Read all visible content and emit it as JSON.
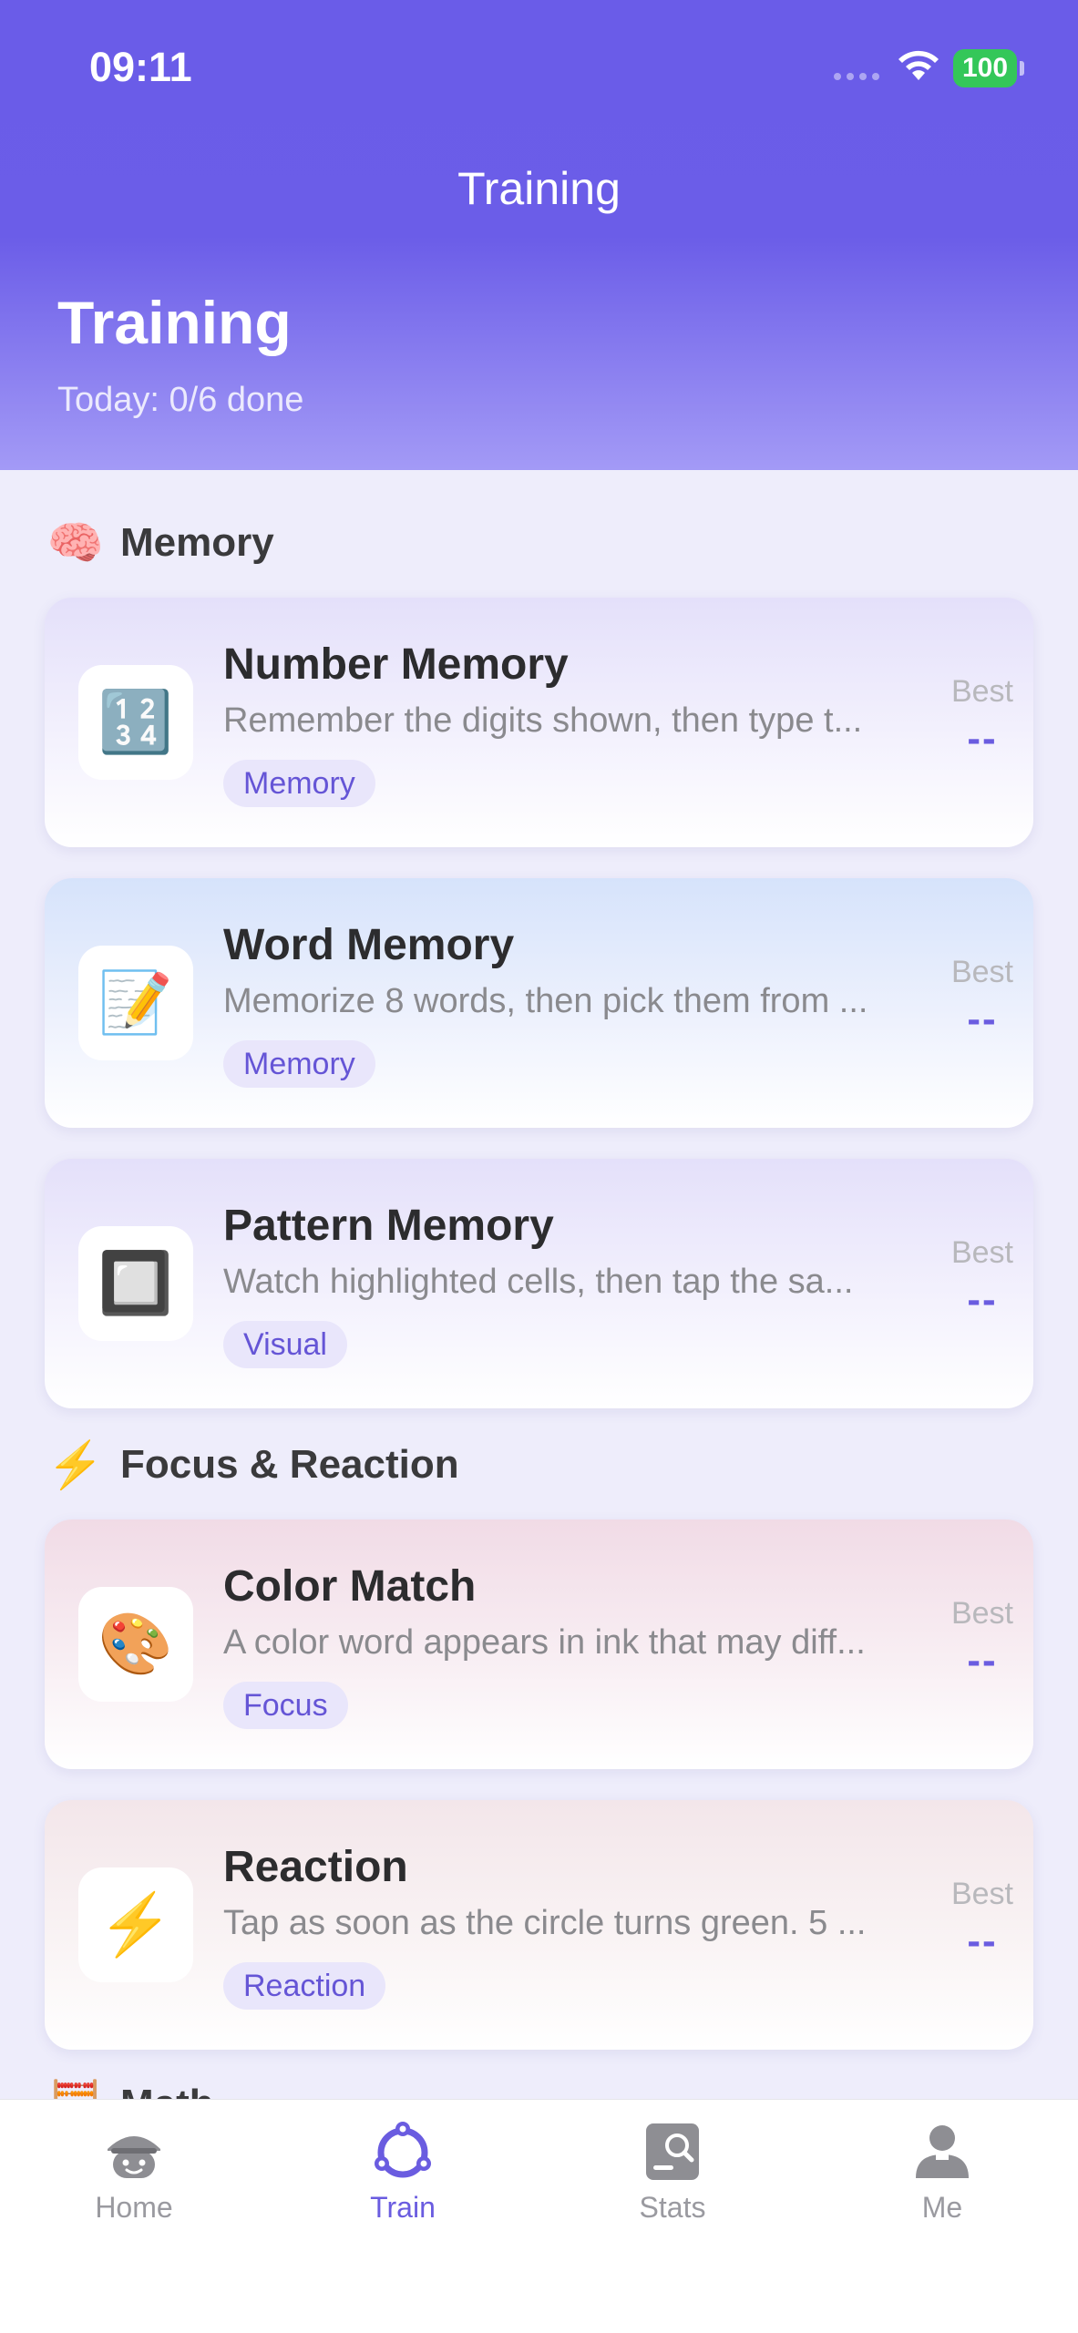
{
  "status": {
    "time": "09:11",
    "battery": "100"
  },
  "nav": {
    "title": "Training"
  },
  "hero": {
    "title": "Training",
    "subtitle": "Today: 0/6 done"
  },
  "sections": [
    {
      "icon": "🧠",
      "label": "Memory"
    },
    {
      "icon": "⚡",
      "label": "Focus & Reaction"
    },
    {
      "icon": "🧮",
      "label": "Math"
    }
  ],
  "cards": [
    {
      "icon": "🔢",
      "title": "Number Memory",
      "description": "Remember the digits shown, then type t...",
      "tag": "Memory",
      "best_label": "Best",
      "best_value": "--"
    },
    {
      "icon": "📝",
      "title": "Word Memory",
      "description": "Memorize 8 words, then pick them from ...",
      "tag": "Memory",
      "best_label": "Best",
      "best_value": "--"
    },
    {
      "icon": "🔲",
      "title": "Pattern Memory",
      "description": "Watch highlighted cells, then tap the sa...",
      "tag": "Visual",
      "best_label": "Best",
      "best_value": "--"
    },
    {
      "icon": "🎨",
      "title": "Color Match",
      "description": "A color word appears in ink that may diff...",
      "tag": "Focus",
      "best_label": "Best",
      "best_value": "--"
    },
    {
      "icon": "⚡",
      "title": "Reaction",
      "description": "Tap as soon as the circle turns green. 5 ...",
      "tag": "Reaction",
      "best_label": "Best",
      "best_value": "--"
    }
  ],
  "tabs": [
    {
      "label": "Home",
      "icon": "home-icon",
      "active": false
    },
    {
      "label": "Train",
      "icon": "train-icon",
      "active": true
    },
    {
      "label": "Stats",
      "icon": "stats-icon",
      "active": false
    },
    {
      "label": "Me",
      "icon": "profile-icon",
      "active": false
    }
  ],
  "colors": {
    "accent": "#6a5ce0",
    "header_top": "#6a5ce8",
    "header_bottom": "#a39af6",
    "battery": "#34c759"
  }
}
